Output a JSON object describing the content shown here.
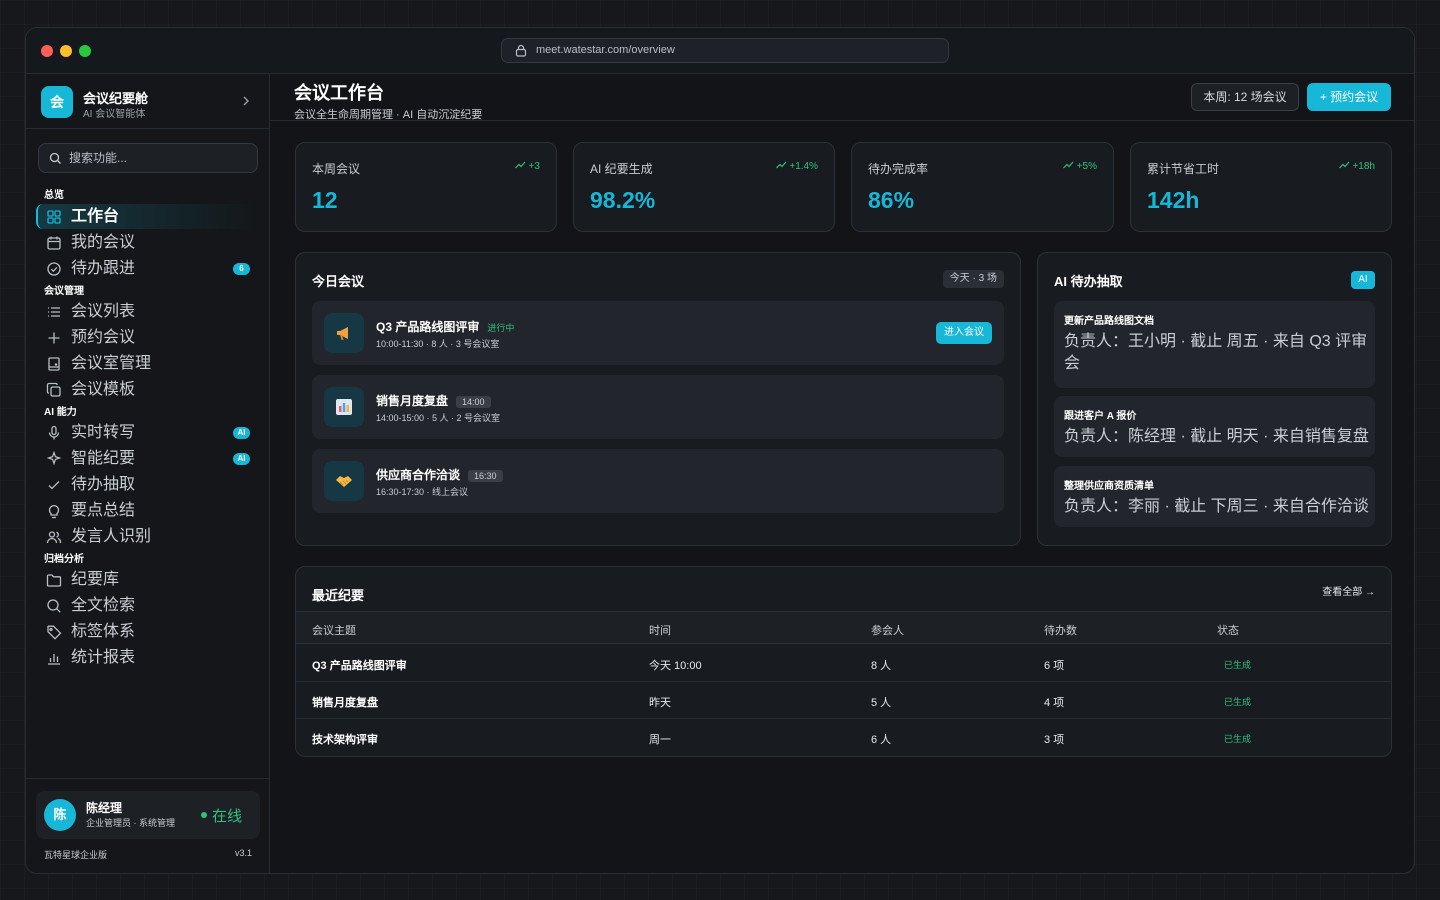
{
  "browser": {
    "url": "meet.watestar.com/overview"
  },
  "brand": {
    "logo_char": "会",
    "name": "会议纪要舱",
    "subtitle": "AI 会议智能体"
  },
  "search": {
    "placeholder": "搜索功能..."
  },
  "sections": {
    "overview": "总览",
    "meeting_mgmt": "会议管理",
    "ai": "AI 能力",
    "archive": "归档分析"
  },
  "nav": {
    "workbench": "工作台",
    "my_meetings": "我的会议",
    "followups": {
      "label": "待办跟进",
      "badge": "6"
    },
    "meeting_list": "会议列表",
    "book_meeting": "预约会议",
    "rooms": "会议室管理",
    "templates": "会议模板",
    "transcription": {
      "label": "实时转写",
      "badge": "AI"
    },
    "smart_minutes": {
      "label": "智能纪要",
      "badge": "AI"
    },
    "todo_extract": "待办抽取",
    "key_summary": "要点总结",
    "speaker_id": "发言人识别",
    "minutes_lib": "纪要库",
    "fulltext": "全文检索",
    "tags": "标签体系",
    "reports": "统计报表"
  },
  "user": {
    "avatar_char": "陈",
    "name": "陈经理",
    "role": "企业管理员 · 系统管理",
    "status": "在线",
    "edition": "瓦特星球企业版",
    "version": "v3.1"
  },
  "header": {
    "title": "会议工作台",
    "subtitle": "会议全生命周期管理 · AI 自动沉淀纪要",
    "week_button": "本周: 12 场会议",
    "book_button": "+ 预约会议"
  },
  "stats": [
    {
      "label": "本周会议",
      "trend": "+3",
      "value": "12"
    },
    {
      "label": "AI 纪要生成",
      "trend": "+1.4%",
      "value": "98.2%"
    },
    {
      "label": "待办完成率",
      "trend": "+5%",
      "value": "86%"
    },
    {
      "label": "累计节省工时",
      "trend": "+18h",
      "value": "142h"
    }
  ],
  "today": {
    "title": "今日会议",
    "pill": "今天 · 3 场",
    "meetings": [
      {
        "title": "Q3 产品路线图评审",
        "tag": "进行中",
        "meta": "10:00-11:30 · 8 人 · 3 号会议室",
        "action": "进入会议"
      },
      {
        "title": "销售月度复盘",
        "tag": "14:00",
        "meta": "14:00-15:00 · 5 人 · 2 号会议室"
      },
      {
        "title": "供应商合作洽谈",
        "tag": "16:30",
        "meta": "16:30-17:30 · 线上会议"
      }
    ]
  },
  "ai_todos": {
    "title": "AI 待办抽取",
    "badge": "AI",
    "items": [
      {
        "title": "更新产品路线图文档",
        "desc": "负责人：王小明 · 截止 周五 · 来自 Q3 评审会"
      },
      {
        "title": "跟进客户 A 报价",
        "desc": "负责人：陈经理 · 截止 明天 · 来自销售复盘"
      },
      {
        "title": "整理供应商资质清单",
        "desc": "负责人：李丽 · 截止 下周三 · 来自合作洽谈"
      }
    ]
  },
  "recent": {
    "title": "最近纪要",
    "view_all": "查看全部 →",
    "columns": [
      "会议主题",
      "时间",
      "参会人",
      "待办数",
      "状态"
    ],
    "rows": [
      [
        "Q3 产品路线图评审",
        "今天 10:00",
        "8 人",
        "6 项",
        "已生成"
      ],
      [
        "销售月度复盘",
        "昨天",
        "5 人",
        "4 项",
        "已生成"
      ],
      [
        "技术架构评审",
        "周一",
        "6 人",
        "3 项",
        "已生成"
      ]
    ]
  },
  "colors": {
    "accent": "#17b7d8",
    "success": "#2ec27e",
    "background": "#121418"
  }
}
